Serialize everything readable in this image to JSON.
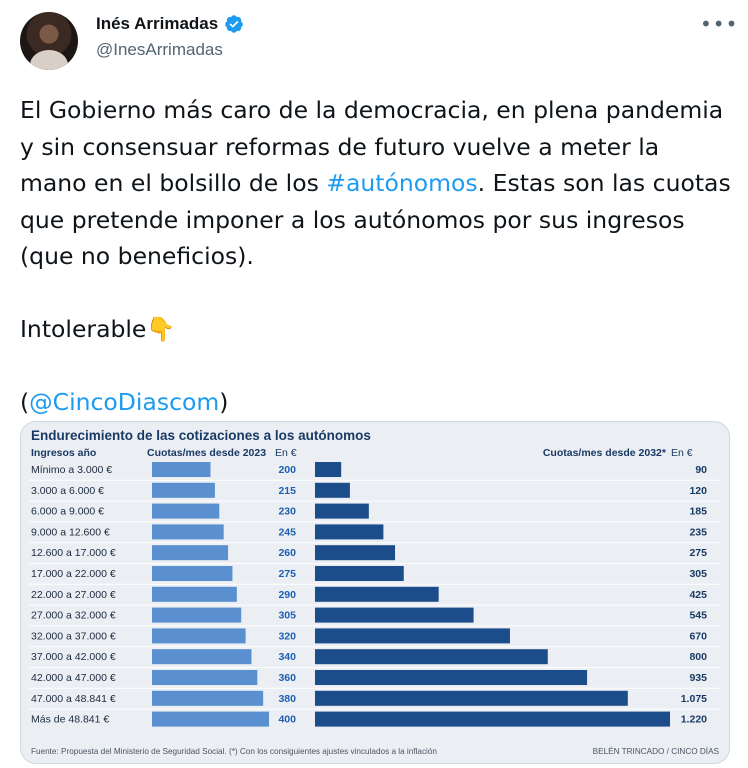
{
  "tweet": {
    "author_name": "Inés Arrimadas",
    "handle": "@InesArrimadas",
    "text_part1": "El Gobierno más caro de la democracia, en plena pandemia y sin consensuar reformas de futuro vuelve a meter la mano en el bolsillo de los ",
    "hashtag": "#autónomos",
    "text_part2": ". Estas son las cuotas que pretende imponer a los autónomos por sus ingresos (que no beneficios).\n\nIntolerable👇\n\n(",
    "mention": "@CincoDiascom",
    "text_part3": ")"
  },
  "icons": {
    "verified": "verified-badge-icon",
    "more": "more-options-icon",
    "accent": "#1d9bf0"
  },
  "chart_data": {
    "type": "bar",
    "title": "Endurecimiento de las cotizaciones a los autónomos",
    "col_label": "Ingresos año",
    "categories": [
      "Mínimo a 3.000 €",
      "3.000 a 6.000 €",
      "6.000 a 9.000 €",
      "9.000 a 12.600 €",
      "12.600 a 17.000 €",
      "17.000 a 22.000 €",
      "22.000 a 27.000 €",
      "27.000 a 32.000 €",
      "32.000 a 37.000 €",
      "37.000 a 42.000 €",
      "42.000 a 47.000 €",
      "47.000 a 48.841 €",
      "Más de 48.841 €"
    ],
    "series": [
      {
        "name": "Cuotas/mes desde 2023",
        "unit": "En €",
        "color": "#5a8fd0",
        "values": [
          200,
          215,
          230,
          245,
          260,
          275,
          290,
          305,
          320,
          340,
          360,
          380,
          400
        ],
        "labels": [
          "200",
          "215",
          "230",
          "245",
          "260",
          "275",
          "290",
          "305",
          "320",
          "340",
          "360",
          "380",
          "400"
        ]
      },
      {
        "name": "Cuotas/mes desde 2032*",
        "unit": "En €",
        "color": "#1c4d8a",
        "values": [
          90,
          120,
          185,
          235,
          275,
          305,
          425,
          545,
          670,
          800,
          935,
          1075,
          1220
        ],
        "labels": [
          "90",
          "120",
          "185",
          "235",
          "275",
          "305",
          "425",
          "545",
          "670",
          "800",
          "935",
          "1.075",
          "1.220"
        ]
      }
    ],
    "source": "Fuente: Propuesta del Ministerio de Seguridad Social. (*) Con los consiguientes ajustes vinculados a la inflación",
    "credit": "BELÉN TRINCADO / CINCO DÍAS"
  }
}
